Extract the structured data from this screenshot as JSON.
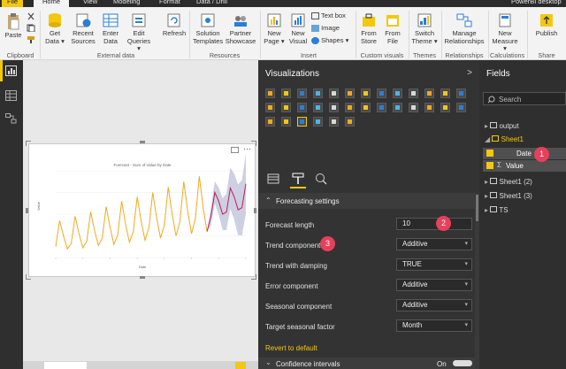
{
  "tabs": {
    "file": "File",
    "home": "Home",
    "view": "View",
    "modeling": "Modeling",
    "format": "Format",
    "data_drill": "Data / Drill",
    "app_title": "PowerBI desktop"
  },
  "ribbon": {
    "paste": "Paste",
    "cut": "Cut",
    "copy": "Copy",
    "format_painter": "Format painter",
    "get_data": "Get Data",
    "recent_sources": "Recent Sources",
    "enter_data": "Enter Data",
    "edit_queries": "Edit Queries",
    "refresh": "Refresh",
    "solution_templates": "Solution Templates",
    "partner_showcase": "Partner Showcase",
    "new_page": "New Page",
    "new_visual": "New Visual",
    "text_box": "Text box",
    "image": "Image",
    "shapes": "Shapes",
    "from_store": "From Store",
    "from_file": "From File",
    "switch_theme": "Switch Theme",
    "manage_relationships": "Manage Relationships",
    "new_measure": "New Measure",
    "publish": "Publish",
    "groups": {
      "clipboard": "Clipboard",
      "external_data": "External data",
      "resources": "Resources",
      "insert": "Insert",
      "custom_visuals": "Custom visuals",
      "themes": "Themes",
      "relationships": "Relationships",
      "calculations": "Calculations",
      "share": "Share"
    }
  },
  "chart": {
    "title": "Forecast - Sum of Value by Date",
    "xlabel": "Date",
    "ylabel": "Value"
  },
  "chart_data": {
    "type": "line",
    "title": "Forecast - Sum of Value by Date",
    "xlabel": "Date",
    "ylabel": "Value",
    "series": [
      {
        "name": "Value",
        "values": [
          10,
          34,
          20,
          8,
          13,
          38,
          22,
          9,
          15,
          42,
          25,
          11,
          18,
          47,
          28,
          12,
          21,
          52,
          31,
          14,
          24,
          56,
          34,
          16,
          27,
          60,
          37,
          18,
          30,
          65,
          40,
          20,
          33,
          70,
          43,
          22,
          36,
          75,
          46,
          24
        ]
      },
      {
        "name": "Forecast",
        "values": [
          38,
          60,
          52,
          40,
          42,
          64,
          56,
          44,
          46,
          68
        ]
      }
    ]
  },
  "visualizations": {
    "title": "Visualizations",
    "expand": ">"
  },
  "format": {
    "section": "Forecasting settings",
    "forecast_length_label": "Forecast length",
    "forecast_length_value": "10",
    "trend_component_label": "Trend component",
    "trend_component_value": "Additive",
    "trend_damping_label": "Trend with damping",
    "trend_damping_value": "TRUE",
    "error_component_label": "Error component",
    "error_component_value": "Additive",
    "seasonal_component_label": "Seasonal component",
    "seasonal_component_value": "Additive",
    "target_seasonal_label": "Target seasonal factor",
    "target_seasonal_value": "Month",
    "revert": "Revert to default",
    "confidence": "Confidence intervals",
    "confidence_state": "On"
  },
  "fields": {
    "title": "Fields",
    "search_placeholder": "Search",
    "output": "output",
    "sheet1": "Sheet1",
    "date": "Date",
    "value": "Value",
    "sheet1_2": "Sheet1 (2)",
    "sheet1_3": "Sheet1 (3)",
    "ts": "TS"
  },
  "badges": {
    "b1": "1",
    "b2": "2",
    "b3": "3"
  },
  "colors": {
    "accent": "#f2c811",
    "line": "#f2a91e",
    "forecast": "#c2185b",
    "badge": "#e6405b"
  }
}
